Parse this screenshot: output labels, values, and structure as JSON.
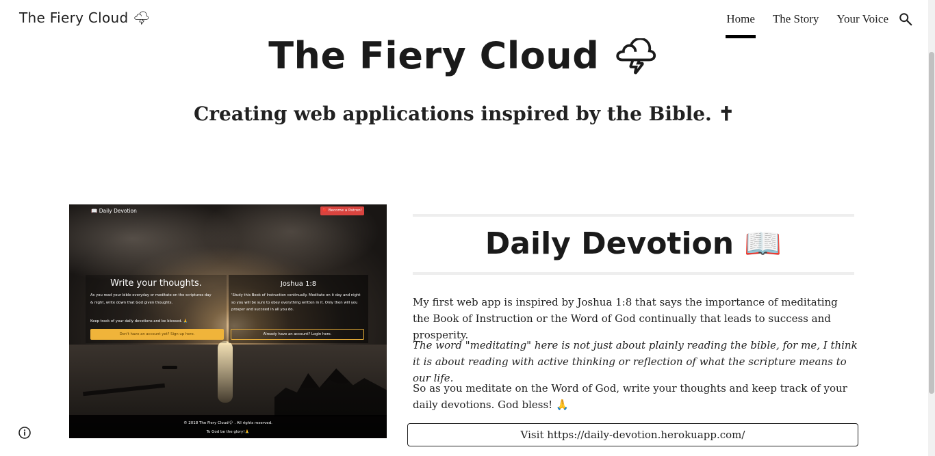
{
  "header": {
    "site_name": "The Fiery Cloud 🌩",
    "nav": [
      {
        "label": "Home",
        "active": true
      },
      {
        "label": "The Story",
        "active": false
      },
      {
        "label": "Your Voice",
        "active": false
      }
    ],
    "search_icon": "search-icon"
  },
  "hero": {
    "title": "The Fiery Cloud 🌩",
    "subtitle": "Creating web applications inspired by the Bible. ✝"
  },
  "screenshot": {
    "brand": "📖 Daily Devotion",
    "patron_button": "🔴 Become a Patron!",
    "left_heading": "Write your thoughts.",
    "left_text": "As you read your bible everyday or meditate on the scriptures day & night, write down that God given thoughts.",
    "left_text2": "Keep track of your daily devotions and be blessed. 🙏",
    "signup_button": "Don't have an account yet? Sign up here.",
    "right_heading": "Joshua 1:8",
    "right_text": "'Study this Book of Instruction continually. Meditate on it day and night so you will be sure to obey everything written in it. Only then will you prosper and succeed in all you do.",
    "login_button": "Already have an account? Login here.",
    "copyright": "© 2018 The Fiery Cloud🌩 . All rights reserved.",
    "glory": "To God be the glory!🙏"
  },
  "section": {
    "title": "Daily Devotion 📖",
    "p1": "My first web app is inspired by Joshua 1:8 that says the importance of meditating the Book of Instruction or the Word of God continually that leads to success and prosperity.",
    "p2": "The word \"meditating\" here is not just about plainly reading the bible, for me, I think it is about reading with active thinking or reflection of what the scripture means to our life.",
    "p3": "So as you meditate on the Word of God, write your thoughts and keep track of your daily devotions. God bless! 🙏",
    "visit_button": "Visit https://daily-devotion.herokuapp.com/"
  },
  "footer": {
    "info_icon": "info-icon"
  }
}
